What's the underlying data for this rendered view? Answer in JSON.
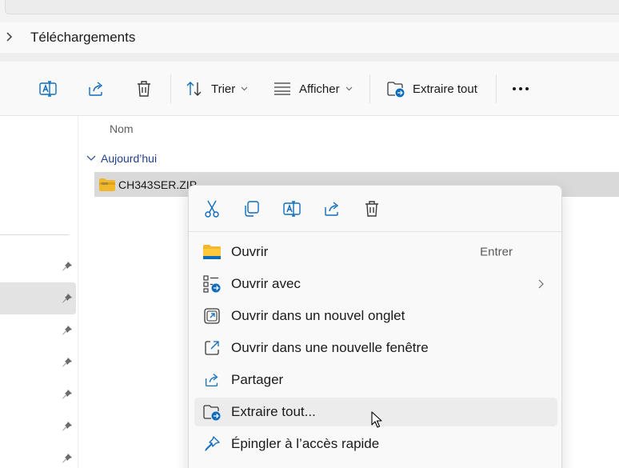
{
  "breadcrumb": {
    "current": "Téléchargements"
  },
  "toolbar": {
    "sort_label": "Trier",
    "view_label": "Afficher",
    "extract_label": "Extraire tout"
  },
  "file_list": {
    "column_name": "Nom",
    "group_label": "Aujourd’hui",
    "files": [
      {
        "name": "CH343SER.ZIP"
      }
    ]
  },
  "context_menu": {
    "items": [
      {
        "label": "Ouvrir",
        "shortcut": "Entrer"
      },
      {
        "label": "Ouvrir avec"
      },
      {
        "label": "Ouvrir dans un nouvel onglet"
      },
      {
        "label": "Ouvrir dans une nouvelle fenêtre"
      },
      {
        "label": "Partager"
      },
      {
        "label": "Extraire tout..."
      },
      {
        "label": "Épingler à l’accès rapide"
      }
    ]
  },
  "colors": {
    "accent": "#0f6cbd",
    "folder": "#f2b82b",
    "selection": "#d9d9d9"
  }
}
